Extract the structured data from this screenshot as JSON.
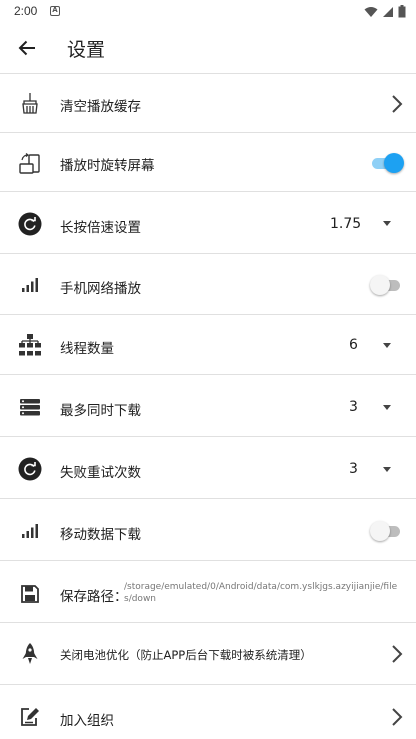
{
  "status_bar": {
    "time": "2:00",
    "notification_glyph": "A"
  },
  "app_bar": {
    "title": "设置",
    "back_icon": "arrow-left-icon"
  },
  "settings": {
    "clear_cache": {
      "label": "清空播放缓存",
      "icon": "broom-icon"
    },
    "rotate_screen": {
      "label": "播放时旋转屏幕",
      "icon": "screen-rotation-icon",
      "enabled": true
    },
    "long_press_speed": {
      "label": "长按倍速设置",
      "icon": "refresh-icon",
      "value": "1.75"
    },
    "mobile_playback": {
      "label": "手机网络播放",
      "icon": "signal-bars-icon",
      "enabled": false
    },
    "thread_count": {
      "label": "线程数量",
      "icon": "network-tree-icon",
      "value": "6"
    },
    "max_downloads": {
      "label": "最多同时下载",
      "icon": "server-stack-icon",
      "value": "3"
    },
    "retry_count": {
      "label": "失败重试次数",
      "icon": "refresh-icon",
      "value": "3"
    },
    "mobile_download": {
      "label": "移动数据下载",
      "icon": "signal-bars-icon",
      "enabled": false
    },
    "save_path": {
      "label": "保存路径：",
      "icon": "floppy-disk-icon",
      "value": "/storage/emulated/0/Android/data/com.yslkjgs.azyijianjie/files/down"
    },
    "battery_opt": {
      "label": "关闭电池优化（防止APP后台下载时被系统清理）",
      "icon": "rocket-icon"
    },
    "join_group": {
      "label": "加入组织",
      "icon": "edit-note-icon"
    }
  },
  "colors": {
    "accent": "#1da1f2",
    "divider": "#e0e0e0",
    "text": "#212121"
  }
}
